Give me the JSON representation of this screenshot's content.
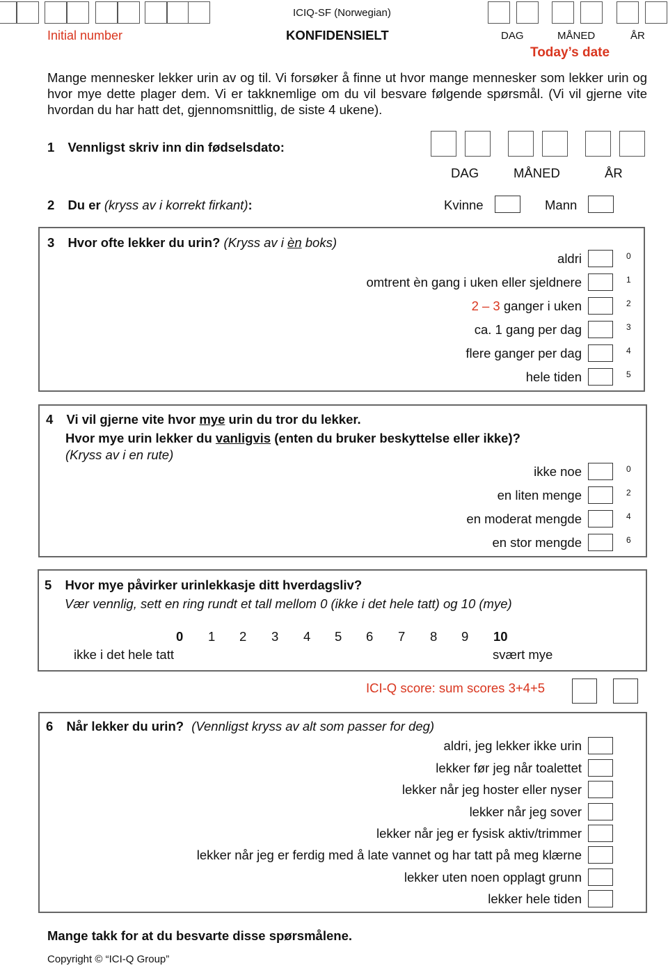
{
  "header": {
    "form_title": "ICIQ-SF (Norwegian)",
    "confidential": "KONFIDENSIELT",
    "initial_number_label": "Initial number",
    "initial_number_groups": [
      2,
      2,
      2,
      3
    ],
    "date_labels": [
      "DAG",
      "MÅNED",
      "ÅR"
    ],
    "today_label": "Today’s date"
  },
  "intro": {
    "text": "Mange mennesker lekker urin av og til. Vi forsøker å finne ut hvor mange mennesker som lekker urin og hvor mye dette plager dem. Vi er takknemlige om du vil besvare følgende spørsmål. (Vi vil gjerne vite hvordan du har hatt det, gjennomsnittlig, de siste 4 ukene)."
  },
  "q1": {
    "number": "1",
    "text": "Vennligst skriv inn din fødselsdato:",
    "date_labels": [
      "DAG",
      "MÅNED",
      "ÅR"
    ]
  },
  "q2": {
    "number": "2",
    "bold": "Du er",
    "italic": "(kryss av i korrekt firkant)",
    "suffix": ":",
    "options": [
      "Kvinne",
      "Mann"
    ]
  },
  "q3": {
    "number": "3",
    "bold": "Hvor ofte lekker du urin?",
    "italic_pre": "(Kryss av i ",
    "italic_underlined": "èn",
    "italic_post": " boks)",
    "options": [
      {
        "label": "aldri",
        "score": "0"
      },
      {
        "label": "omtrent èn gang i uken eller sjeldnere",
        "score": "1"
      },
      {
        "label_red": "2 – 3",
        "label": " ganger i uken",
        "score": "2"
      },
      {
        "label": "ca. 1 gang per dag",
        "score": "3"
      },
      {
        "label": "flere ganger per dag",
        "score": "4"
      },
      {
        "label": "hele tiden",
        "score": "5"
      }
    ]
  },
  "q4": {
    "number": "4",
    "line1_pre": "Vi vil gjerne vite hvor ",
    "line1_u": "mye",
    "line1_post": " urin du tror du lekker.",
    "line2_pre": "Hvor mye urin lekker du ",
    "line2_u": "vanligvis",
    "line2_post": " (enten du bruker beskyttelse eller ikke)?",
    "instruction": "(Kryss av i en rute)",
    "options": [
      {
        "label": "ikke noe",
        "score": "0"
      },
      {
        "label": "en liten menge",
        "score": "2"
      },
      {
        "label": "en moderat mengde",
        "score": "4"
      },
      {
        "label": "en stor mengde",
        "score": "6"
      }
    ]
  },
  "q5": {
    "number": "5",
    "bold": "Hvor mye påvirker urinlekkasje ditt hverdagsliv?",
    "instruction": "Vær vennlig, sett en ring rundt et tall mellom 0 (ikke i det hele tatt) og 10 (mye)",
    "scale": [
      "0",
      "1",
      "2",
      "3",
      "4",
      "5",
      "6",
      "7",
      "8",
      "9",
      "10"
    ],
    "low_label": "ikke i det hele tatt",
    "high_label": "svært mye"
  },
  "score": {
    "label": "ICI-Q score: sum scores 3+4+5"
  },
  "q6": {
    "number": "6",
    "bold": "Når lekker du urin?",
    "italic": "(Vennligst kryss av alt som passer for deg)",
    "options": [
      "aldri, jeg lekker ikke urin",
      "lekker før jeg når toalettet",
      "lekker når jeg hoster eller nyser",
      "lekker når jeg sover",
      "lekker når jeg er fysisk aktiv/trimmer",
      "lekker når jeg er ferdig med å late vannet og har tatt på meg klærne",
      "lekker uten noen opplagt grunn",
      "lekker hele tiden"
    ]
  },
  "footer": {
    "thanks": "Mange takk for at du besvarte disse spørsmålene.",
    "copyright": "Copyright © “ICI-Q Group”"
  },
  "colors": {
    "accent_red": "#d9361f"
  }
}
